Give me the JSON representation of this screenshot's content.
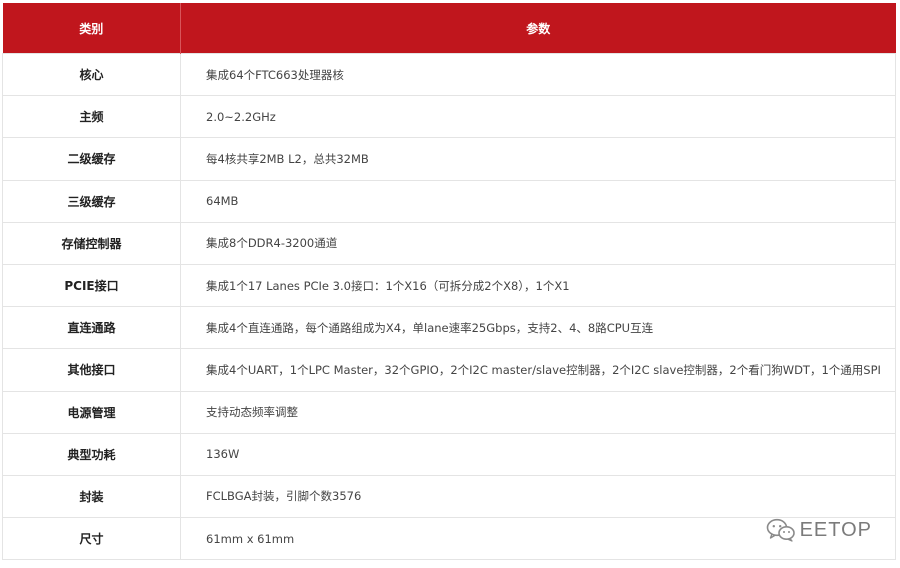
{
  "table": {
    "headers": {
      "category": "类别",
      "parameter": "参数"
    },
    "rows": [
      {
        "category": "核心",
        "value": "集成64个FTC663处理器核"
      },
      {
        "category": "主频",
        "value": "2.0~2.2GHz"
      },
      {
        "category": "二级缓存",
        "value": "每4核共享2MB L2，总共32MB"
      },
      {
        "category": "三级缓存",
        "value": "64MB"
      },
      {
        "category": "存储控制器",
        "value": "集成8个DDR4-3200通道"
      },
      {
        "category": "PCIE接口",
        "value": "集成1个17 Lanes PCIe 3.0接口：1个X16（可拆分成2个X8），1个X1"
      },
      {
        "category": "直连通路",
        "value": "集成4个直连通路，每个通路组成为X4，单lane速率25Gbps，支持2、4、8路CPU互连"
      },
      {
        "category": "其他接口",
        "value": "集成4个UART，1个LPC Master，32个GPIO，2个I2C master/slave控制器，2个I2C slave控制器，2个看门狗WDT，1个通用SPI"
      },
      {
        "category": "电源管理",
        "value": "支持动态频率调整"
      },
      {
        "category": "典型功耗",
        "value": "136W"
      },
      {
        "category": "封装",
        "value": "FCLBGA封装，引脚个数3576"
      },
      {
        "category": "尺寸",
        "value": "61mm x 61mm"
      }
    ]
  },
  "watermark": {
    "text": "EETOP",
    "icon": "wechat-icon"
  },
  "colors": {
    "header_bg": "#c0161d",
    "header_text": "#ffffff",
    "border": "#e4e4e4"
  }
}
